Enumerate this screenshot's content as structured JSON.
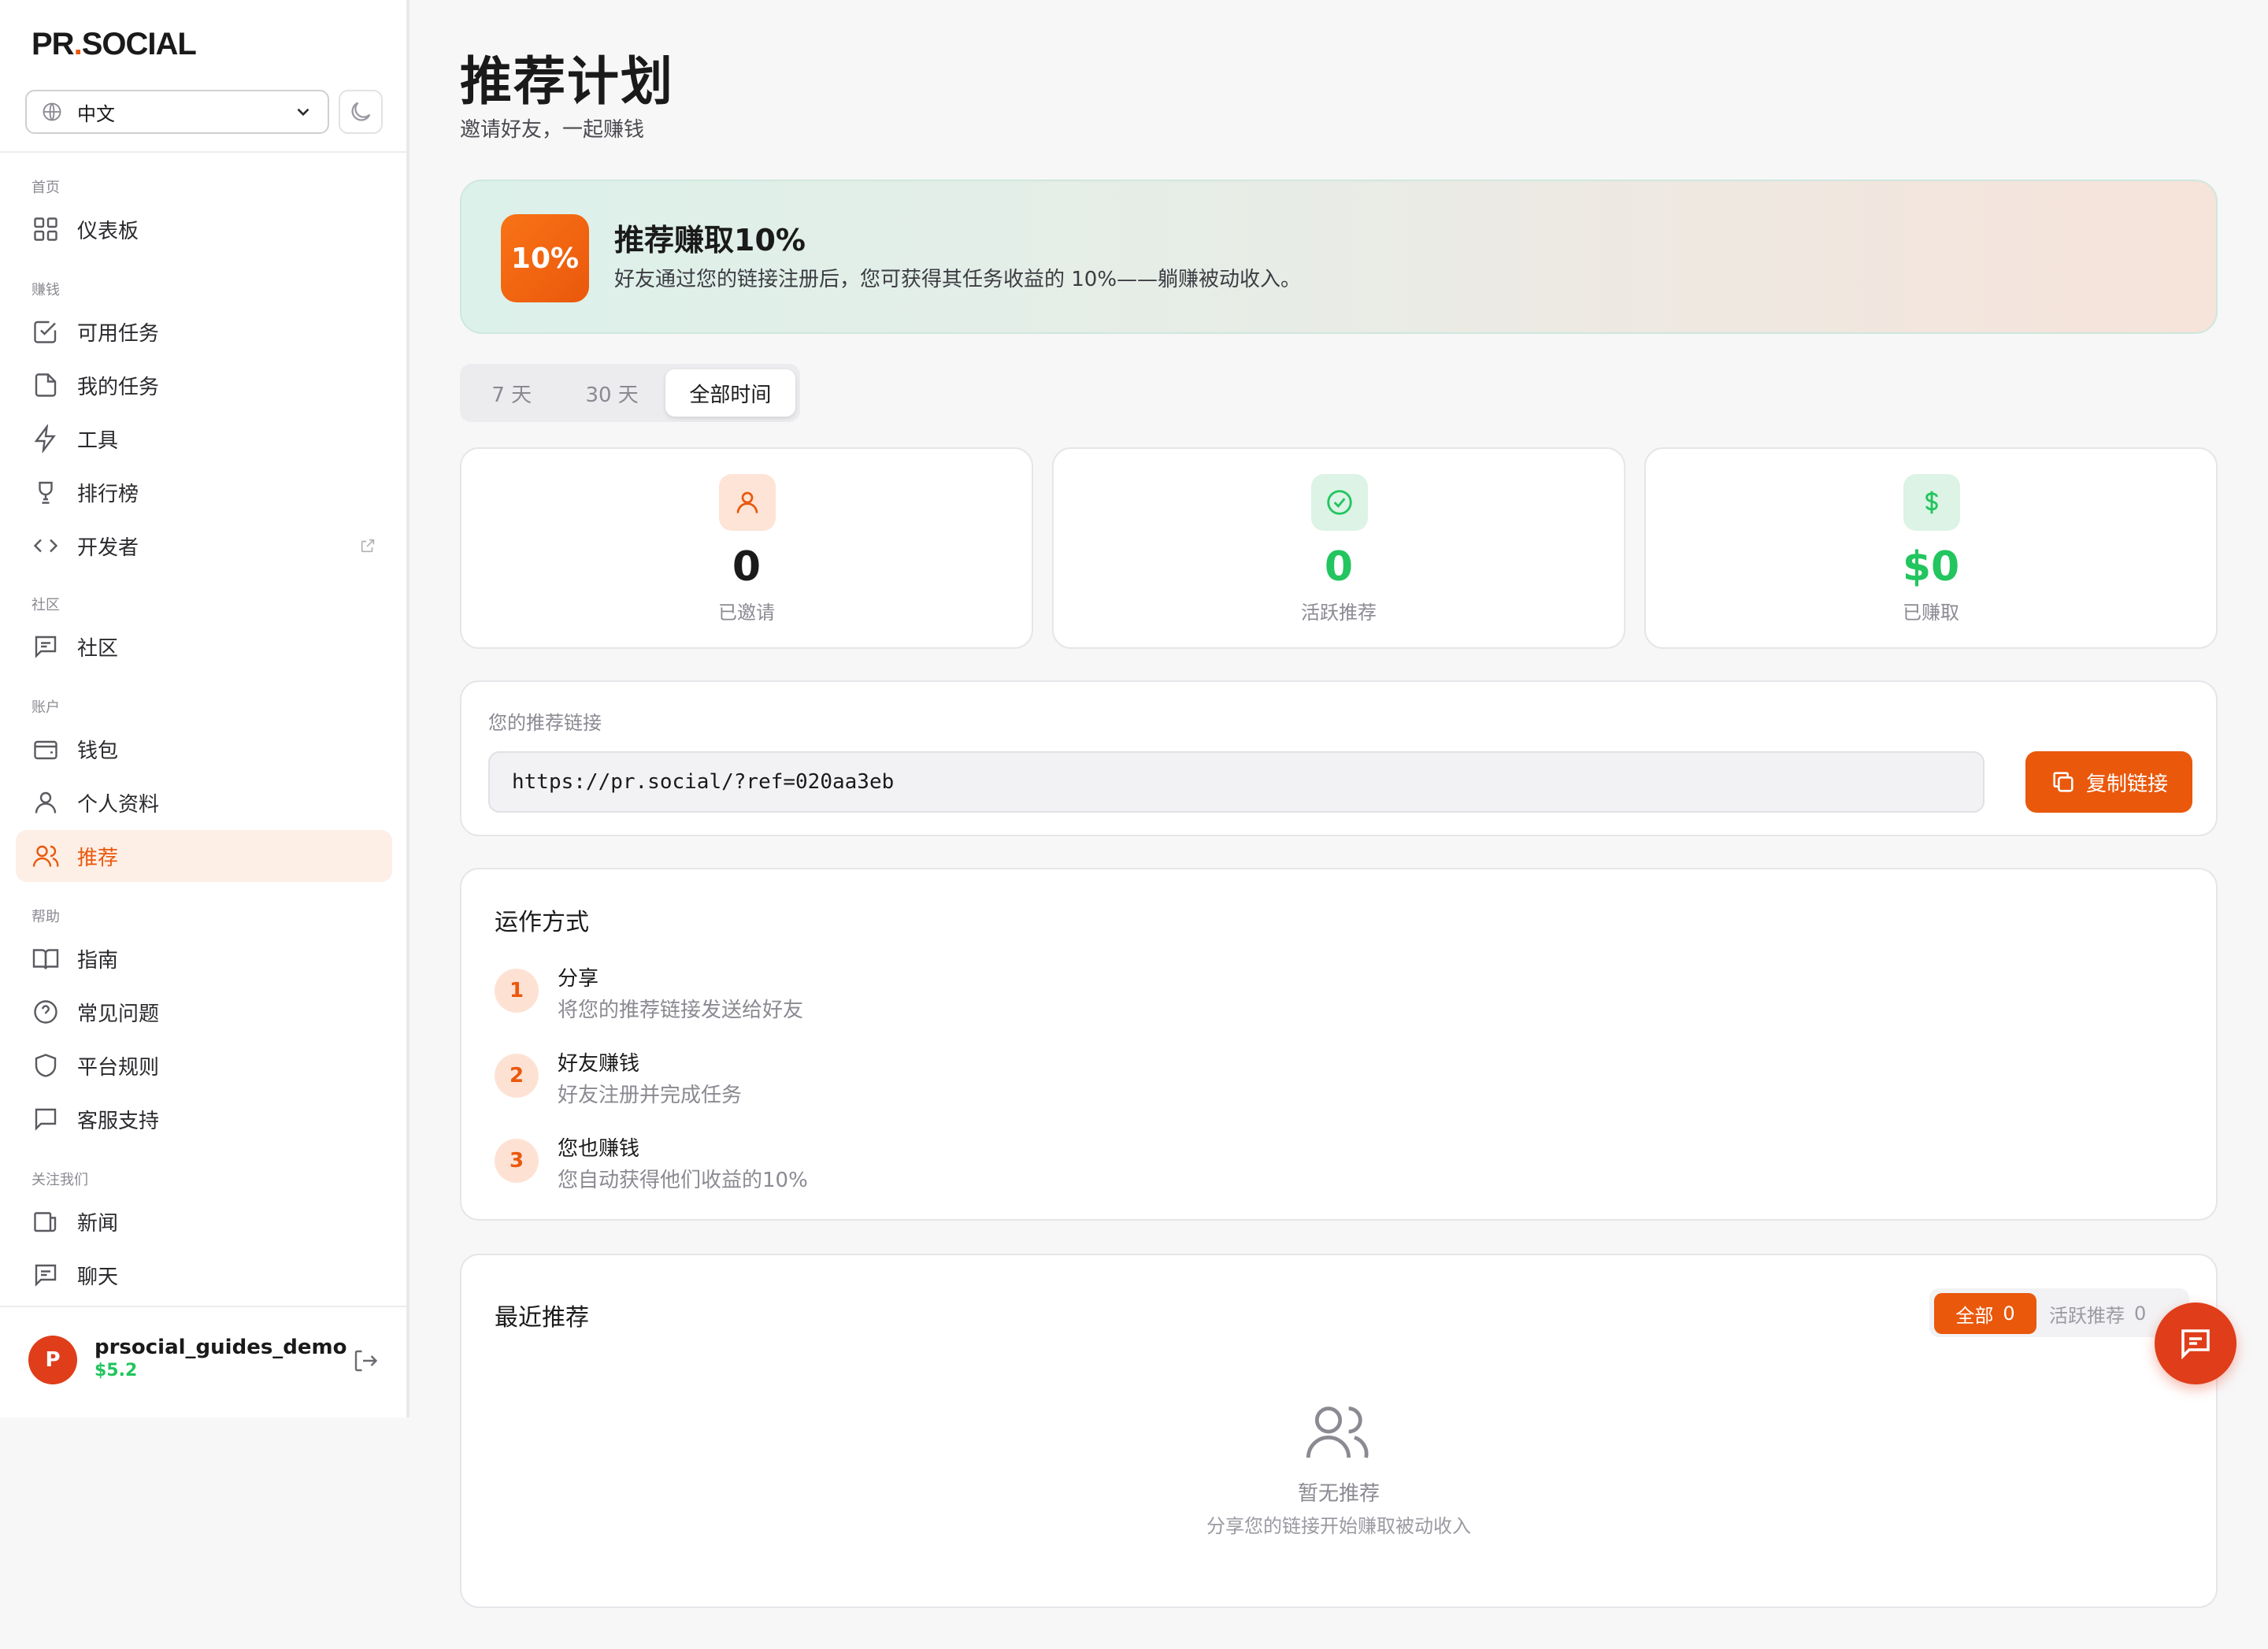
{
  "brand": {
    "prefix": "PR",
    "dot": ".",
    "suffix": "SOCIAL"
  },
  "language": {
    "selected": "中文"
  },
  "nav": {
    "sections": {
      "home": "首页",
      "earn": "赚钱",
      "community": "社区",
      "account": "账户",
      "help": "帮助",
      "follow": "关注我们"
    },
    "items": {
      "dashboard": "仪表板",
      "available_tasks": "可用任务",
      "my_tasks": "我的任务",
      "tools": "工具",
      "leaderboard": "排行榜",
      "developer": "开发者",
      "community": "社区",
      "wallet": "钱包",
      "profile": "个人资料",
      "referral": "推荐",
      "guide": "指南",
      "faq": "常见问题",
      "rules": "平台规则",
      "support": "客服支持",
      "news": "新闻",
      "chat": "聊天"
    }
  },
  "user": {
    "initial": "P",
    "name": "prsocial_guides_demo",
    "balance": "$5.2"
  },
  "page": {
    "title": "推荐计划",
    "subtitle": "邀请好友，一起赚钱"
  },
  "banner": {
    "badge": "10%",
    "title": "推荐赚取10%",
    "description": "好友通过您的链接注册后，您可获得其任务收益的 10%——躺赚被动收入。"
  },
  "periods": {
    "p7": "7 天",
    "p30": "30 天",
    "all": "全部时间",
    "selected": "全部时间"
  },
  "stats": {
    "invited": {
      "value": "0",
      "label": "已邀请"
    },
    "active": {
      "value": "0",
      "label": "活跃推荐"
    },
    "earned": {
      "value": "$0",
      "label": "已赚取"
    }
  },
  "referral_link": {
    "label": "您的推荐链接",
    "value": "https://pr.social/?ref=020aa3eb",
    "copy_label": "复制链接"
  },
  "how_it_works": {
    "title": "运作方式",
    "steps": [
      {
        "num": "1",
        "title": "分享",
        "desc": "将您的推荐链接发送给好友"
      },
      {
        "num": "2",
        "title": "好友赚钱",
        "desc": "好友注册并完成任务"
      },
      {
        "num": "3",
        "title": "您也赚钱",
        "desc": "您自动获得他们收益的10%"
      }
    ]
  },
  "recent": {
    "title": "最近推荐",
    "tabs": {
      "all": {
        "label": "全部",
        "count": "0"
      },
      "active": {
        "label": "活跃推荐",
        "count": "0"
      }
    },
    "empty_title": "暂无推荐",
    "empty_desc": "分享您的链接开始赚取被动收入"
  },
  "colors": {
    "accent": "#ea580c",
    "success": "#22c55e",
    "avatar": "#e03d1a"
  }
}
